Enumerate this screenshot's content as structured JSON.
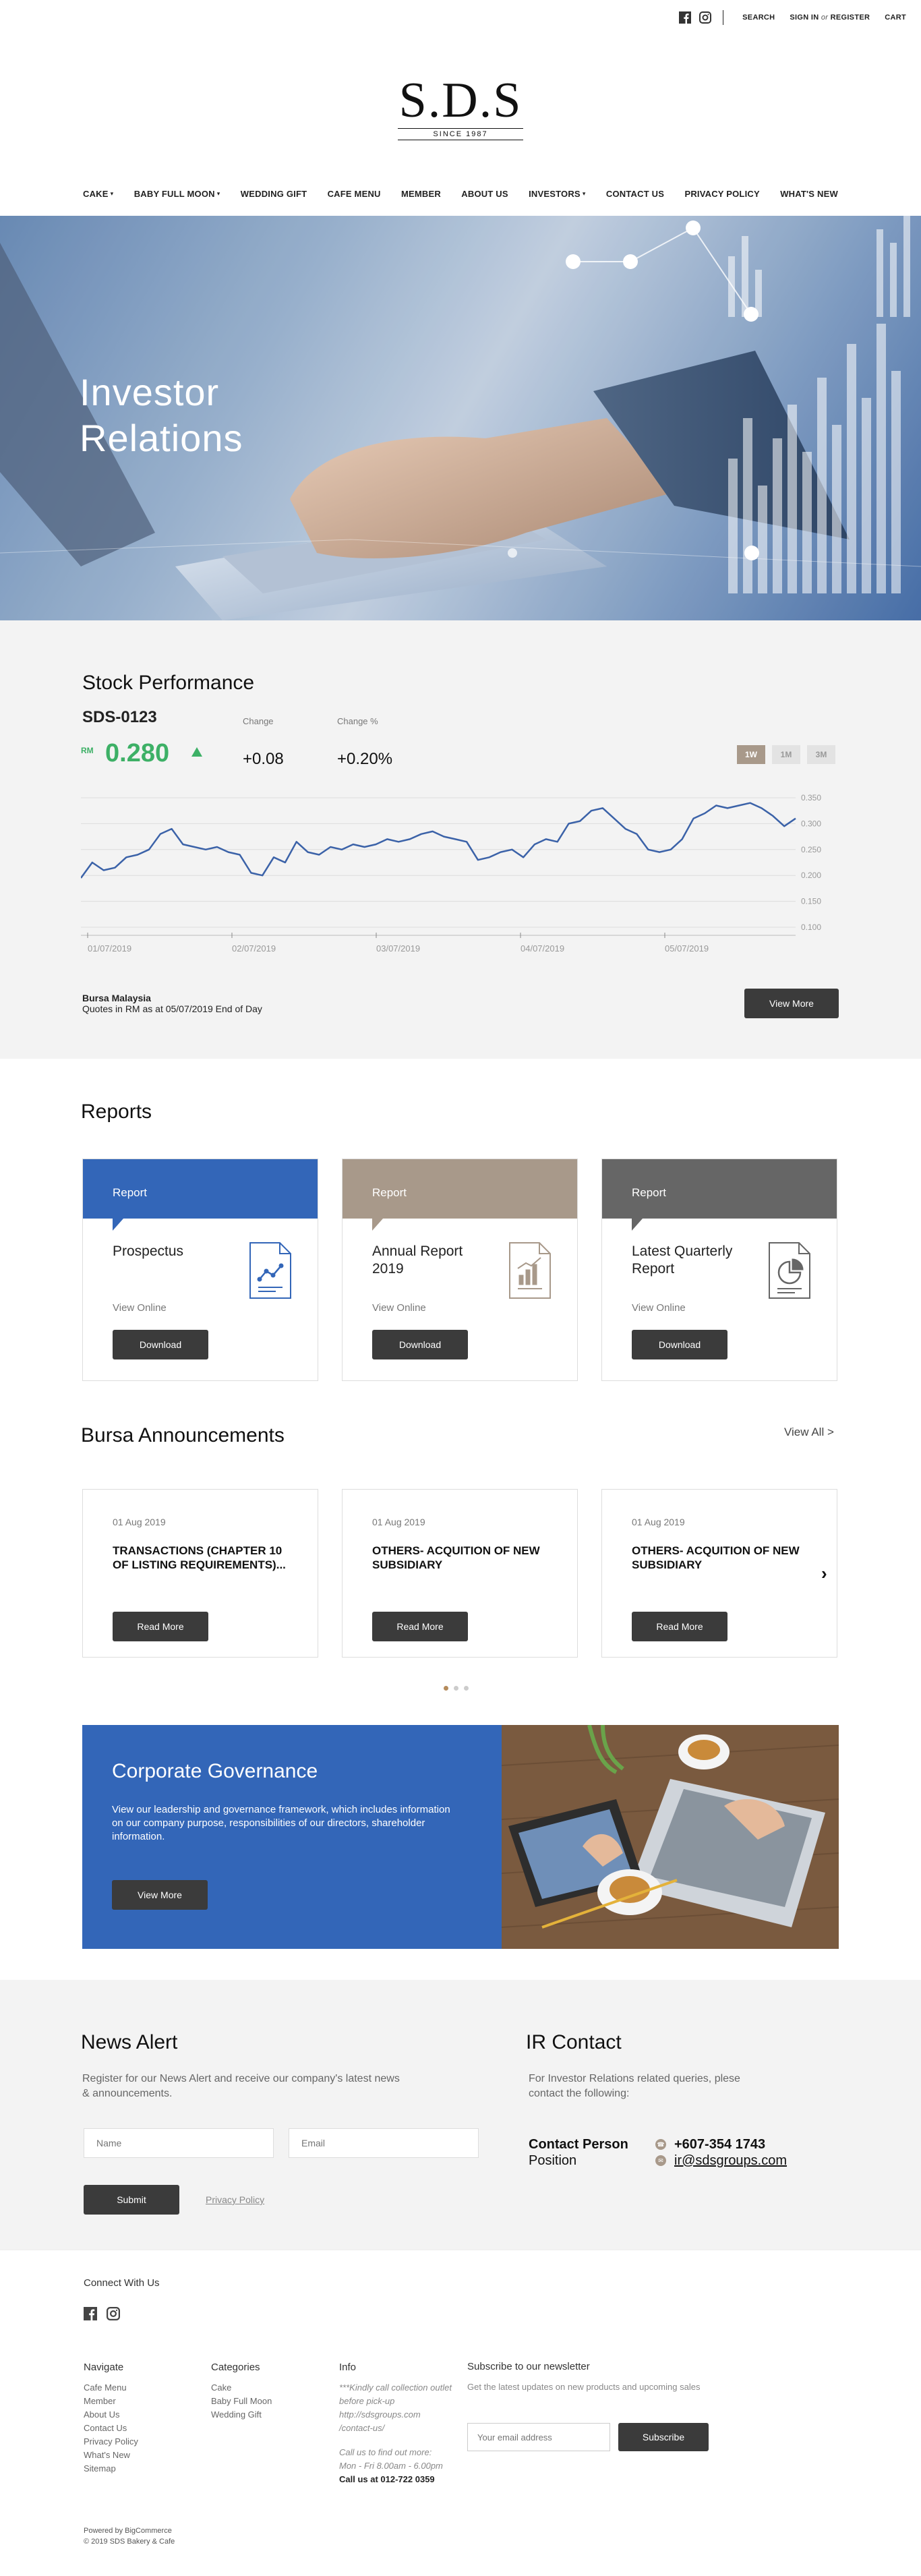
{
  "topbar": {
    "search": "SEARCH",
    "sign_in": "SIGN IN",
    "or": "or",
    "register": "REGISTER",
    "cart": "CART"
  },
  "logo": {
    "mark": "S.D.S",
    "since": "SINCE 1987"
  },
  "nav": [
    {
      "label": "CAKE",
      "dropdown": true
    },
    {
      "label": "BABY FULL MOON",
      "dropdown": true
    },
    {
      "label": "WEDDING GIFT",
      "dropdown": false
    },
    {
      "label": "CAFE MENU",
      "dropdown": false
    },
    {
      "label": "MEMBER",
      "dropdown": false
    },
    {
      "label": "ABOUT US",
      "dropdown": false
    },
    {
      "label": "INVESTORS",
      "dropdown": true
    },
    {
      "label": "CONTACT US",
      "dropdown": false
    },
    {
      "label": "PRIVACY POLICY",
      "dropdown": false
    },
    {
      "label": "WHAT'S NEW",
      "dropdown": false
    }
  ],
  "hero": {
    "line1": "Investor",
    "line2": "Relations"
  },
  "stock": {
    "title": "Stock Performance",
    "code": "SDS-0123",
    "currency": "RM",
    "price": "0.280",
    "change_label": "Change",
    "change": "+0.08",
    "change_pct_label": "Change %",
    "change_pct": "+0.20%",
    "ranges": [
      "1W",
      "1M",
      "3M"
    ],
    "active_range": "1W",
    "source": "Bursa Malaysia",
    "note": "Quotes in RM as at 05/07/2019 End of Day",
    "view_more": "View More",
    "colors": {
      "up": "#3db066",
      "line": "#3b62a8"
    }
  },
  "chart_data": {
    "type": "line",
    "title": "",
    "x_ticks": [
      "01/07/2019",
      "02/07/2019",
      "03/07/2019",
      "04/07/2019",
      "05/07/2019"
    ],
    "y_ticks": [
      "0.350",
      "0.300",
      "0.250",
      "0.200",
      "0.150",
      "0.100"
    ],
    "ylim": [
      0.1,
      0.35
    ],
    "grid": true,
    "series": [
      {
        "values": [
          0.195,
          0.225,
          0.21,
          0.215,
          0.235,
          0.24,
          0.25,
          0.28,
          0.29,
          0.26,
          0.255,
          0.25,
          0.255,
          0.245,
          0.24,
          0.205,
          0.2,
          0.235,
          0.225,
          0.265,
          0.245,
          0.24,
          0.255,
          0.25,
          0.26,
          0.255,
          0.26,
          0.27,
          0.265,
          0.27,
          0.28,
          0.285,
          0.275,
          0.27,
          0.265,
          0.23,
          0.235,
          0.245,
          0.25,
          0.235,
          0.26,
          0.27,
          0.265,
          0.3,
          0.305,
          0.325,
          0.33,
          0.31,
          0.29,
          0.28,
          0.25,
          0.245,
          0.25,
          0.27,
          0.31,
          0.32,
          0.335,
          0.33,
          0.335,
          0.34,
          0.33,
          0.315,
          0.295,
          0.31
        ]
      }
    ]
  },
  "reports": {
    "title": "Reports",
    "band_label": "Report",
    "view_online": "View Online",
    "download": "Download",
    "items": [
      {
        "name": "Prospectus",
        "color": "#3366b8"
      },
      {
        "name": "Annual Report 2019",
        "color": "#a8998a"
      },
      {
        "name": "Latest Quarterly Report",
        "color": "#666666"
      }
    ]
  },
  "announcements": {
    "title": "Bursa Announcements",
    "view_all": "View All >",
    "read_more": "Read More",
    "items": [
      {
        "date": "01 Aug 2019",
        "headline": "TRANSACTIONS (CHAPTER 10 OF LISTING REQUIREMENTS)..."
      },
      {
        "date": "01 Aug 2019",
        "headline": "OTHERS- ACQUITION OF NEW SUBSIDIARY"
      },
      {
        "date": "01 Aug 2019",
        "headline": "OTHERS- ACQUITION OF NEW SUBSIDIARY"
      }
    ]
  },
  "governance": {
    "title": "Corporate Governance",
    "desc": "View our leadership and governance framework, which includes information on our company purpose, responsibilities of our directors, shareholder information.",
    "view_more": "View More"
  },
  "news_alert": {
    "title": "News Alert",
    "desc": "Register for our News Alert and receive our company's latest news & announcements.",
    "name_placeholder": "Name",
    "email_placeholder": "Email",
    "submit": "Submit",
    "privacy": "Privacy Policy"
  },
  "ir_contact": {
    "title": "IR Contact",
    "desc": "For Investor Relations related queries, plese contact the following:",
    "contact_person_label": "Contact Person",
    "position_label": "Position",
    "phone": "+607-354 1743",
    "email": "ir@sdsgroups.com"
  },
  "footer": {
    "connect": "Connect With Us",
    "navigate": {
      "title": "Navigate",
      "items": [
        "Cafe Menu",
        "Member",
        "About Us",
        "Contact Us",
        "Privacy Policy",
        "What's New",
        "Sitemap"
      ]
    },
    "categories": {
      "title": "Categories",
      "items": [
        "Cake",
        "Baby Full Moon",
        "Wedding Gift"
      ]
    },
    "info": {
      "title": "Info",
      "l1": "***Kindly call collection outlet before pick-up",
      "l2": "http://sdsgroups.com /contact-us/",
      "l3": "Call us to find out more:",
      "l4": "Mon - Fri 8.00am - 6.00pm",
      "l5": "Call us at 012-722 0359"
    },
    "newsletter": {
      "title": "Subscribe to our newsletter",
      "desc": "Get the latest updates on new products and upcoming sales",
      "placeholder": "Your email address",
      "subscribe": "Subscribe"
    },
    "powered": "Powered by BigCommerce",
    "copyright": "© 2019 SDS Bakery & Cafe"
  }
}
